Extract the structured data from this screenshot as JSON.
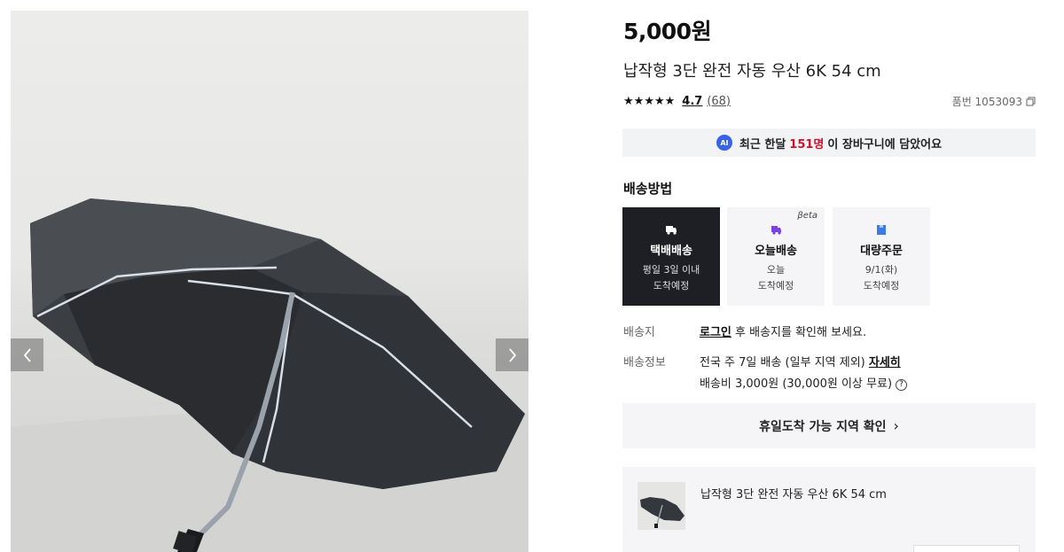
{
  "product": {
    "price": "5,000원",
    "title": "납작형 3단 완전 자동 우산 6K 54 cm",
    "rating": "4.7",
    "review_count": "(68)",
    "star_count": 5,
    "product_code": "품번 1053093"
  },
  "ai_banner": {
    "badge": "AI",
    "prefix": "최근 한달",
    "count": "151명",
    "suffix": "이 장바구니에 담았어요",
    "count_color": "#d0112b"
  },
  "shipping": {
    "title": "배송방법",
    "options": [
      {
        "name": "택배배송",
        "line1": "평일 3일 이내",
        "line2": "도착예정",
        "icon": "truck-icon",
        "selected": true
      },
      {
        "name": "오늘배송",
        "line1": "오늘",
        "line2": "도착예정",
        "icon": "fast-delivery-icon",
        "badge": "βeta",
        "selected": false
      },
      {
        "name": "대량주문",
        "line1": "9/1(화)",
        "line2": "도착예정",
        "icon": "box-icon",
        "selected": false
      }
    ],
    "destination_label": "배송지",
    "destination_link": "로그인",
    "destination_text": " 후 배송지를 확인해 보세요.",
    "info_label": "배송정보",
    "info_text": "전국 주 7일 배송 (일부 지역 제외) ",
    "info_link": "자세히",
    "fee_text": "배송비 3,000원 (30,000원 이상 무료)",
    "help_glyph": "?"
  },
  "holiday_button": {
    "label": "휴일도착 가능 지역 확인",
    "chevron": "›"
  },
  "selected_item": {
    "name": "납작형 3단 완전 자동 우산 6K 54 cm"
  },
  "gallery": {
    "prev_glyph": "‹",
    "next_glyph": "›"
  },
  "colors": {
    "selected_option_bg": "#1d1f24",
    "panel_bg": "#f5f5f7",
    "ai_blue": "#3a63e8"
  }
}
